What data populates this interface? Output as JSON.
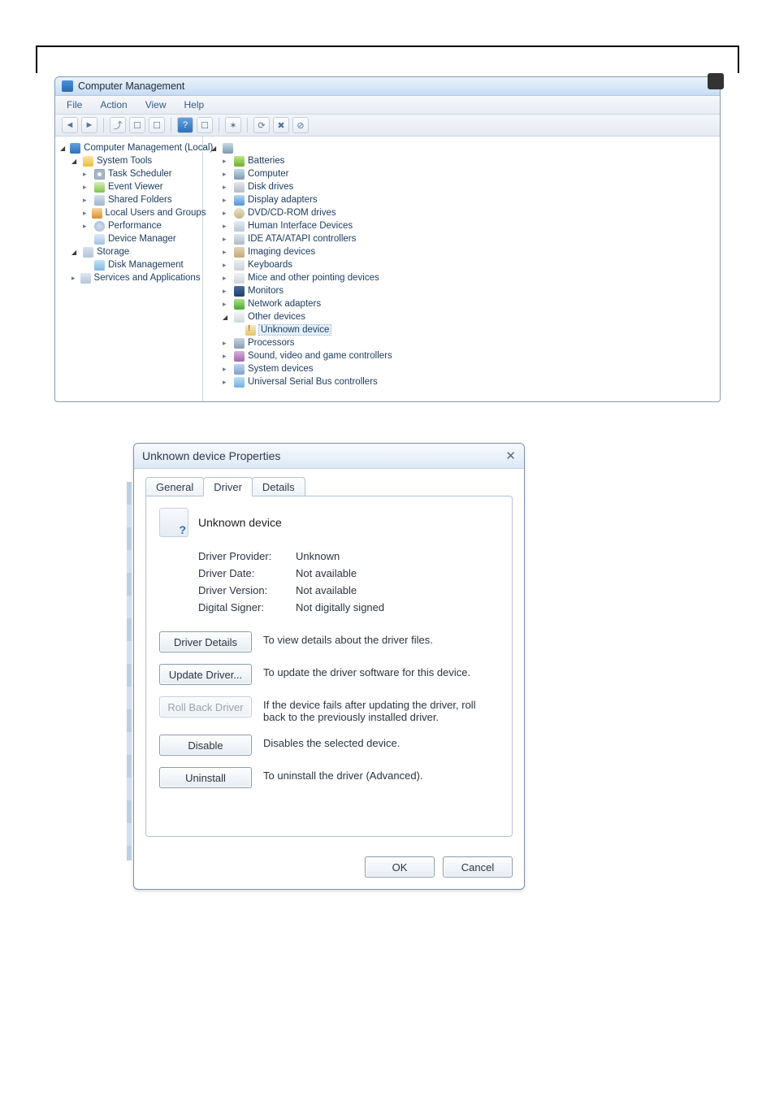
{
  "cm": {
    "title": "Computer Management",
    "menu": [
      "File",
      "Action",
      "View",
      "Help"
    ],
    "left_tree": {
      "root": "Computer Management (Local)",
      "system_tools": "System Tools",
      "task_scheduler": "Task Scheduler",
      "event_viewer": "Event Viewer",
      "shared_folders": "Shared Folders",
      "local_users": "Local Users and Groups",
      "performance": "Performance",
      "device_manager": "Device Manager",
      "storage": "Storage",
      "disk_management": "Disk Management",
      "services": "Services and Applications"
    },
    "devices": {
      "batteries": "Batteries",
      "computer": "Computer",
      "disk_drives": "Disk drives",
      "display_adapters": "Display adapters",
      "dvd": "DVD/CD-ROM drives",
      "hid": "Human Interface Devices",
      "ide": "IDE ATA/ATAPI controllers",
      "imaging": "Imaging devices",
      "keyboards": "Keyboards",
      "mice": "Mice and other pointing devices",
      "monitors": "Monitors",
      "network": "Network adapters",
      "other": "Other devices",
      "unknown": "Unknown device",
      "processors": "Processors",
      "sound": "Sound, video and game controllers",
      "system": "System devices",
      "usb": "Universal Serial Bus controllers"
    }
  },
  "dlg": {
    "title": "Unknown device Properties",
    "tabs": {
      "general": "General",
      "driver": "Driver",
      "details": "Details"
    },
    "device_name": "Unknown device",
    "rows": {
      "provider_label": "Driver Provider:",
      "provider_value": "Unknown",
      "date_label": "Driver Date:",
      "date_value": "Not available",
      "version_label": "Driver Version:",
      "version_value": "Not available",
      "signer_label": "Digital Signer:",
      "signer_value": "Not digitally signed"
    },
    "buttons": {
      "details": "Driver Details",
      "details_desc": "To view details about the driver files.",
      "update": "Update Driver...",
      "update_desc": "To update the driver software for this device.",
      "rollback": "Roll Back Driver",
      "rollback_desc": "If the device fails after updating the driver, roll back to the previously installed driver.",
      "disable": "Disable",
      "disable_desc": "Disables the selected device.",
      "uninstall": "Uninstall",
      "uninstall_desc": "To uninstall the driver (Advanced)."
    },
    "ok": "OK",
    "cancel": "Cancel"
  }
}
